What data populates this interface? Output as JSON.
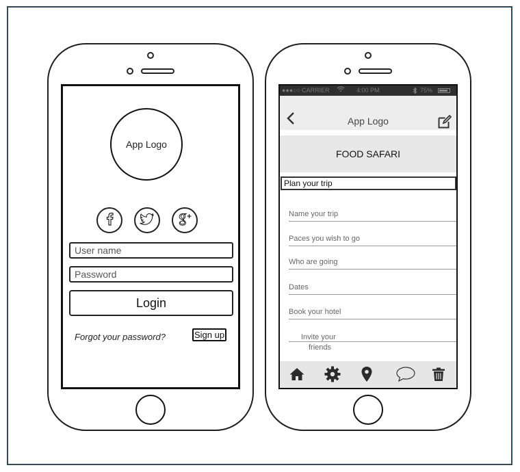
{
  "login_screen": {
    "logo_text": "App Logo",
    "social": [
      "facebook-icon",
      "twitter-icon",
      "google-plus-icon"
    ],
    "username_placeholder": "User name",
    "password_placeholder": "Password",
    "login_label": "Login",
    "forgot_label": "Forgot your password?",
    "signup_label": "Sign up"
  },
  "trip_screen": {
    "status": {
      "carrier": "CARRIER",
      "time": "4:00 PM",
      "battery": "75%"
    },
    "nav": {
      "back_icon": "chevron-left-icon",
      "title": "App Logo",
      "edit_icon": "edit-icon"
    },
    "banner": "FOOD SAFARI",
    "section_header": "Plan your trip",
    "fields": [
      "Name your trip",
      "Paces you wish to go",
      "Who are going",
      "Dates",
      "Book your hotel"
    ],
    "invite": {
      "line1": "Invite your",
      "line2": "friends"
    },
    "tabs": [
      "home-icon",
      "gear-icon",
      "map-pin-icon",
      "chat-bubble-icon",
      "trash-icon"
    ]
  }
}
